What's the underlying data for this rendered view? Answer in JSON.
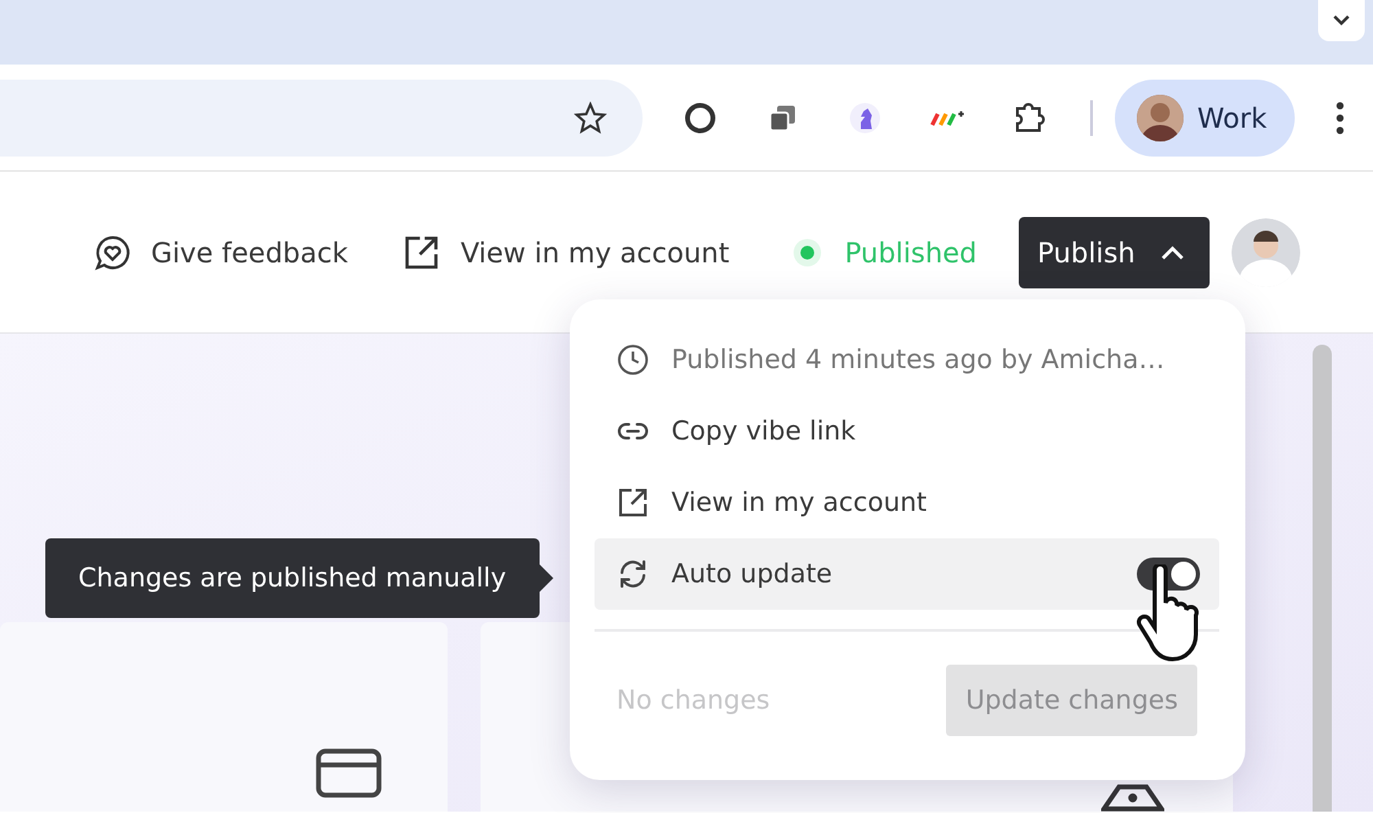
{
  "browser": {
    "profile": {
      "label": "Work"
    }
  },
  "header": {
    "feedback": "Give feedback",
    "view_account": "View in my account",
    "status": "Published",
    "publish_button": {
      "label": "Publish",
      "expanded": true
    }
  },
  "publish_menu": {
    "items": [
      {
        "kind": "info",
        "label": "Published 4 minutes ago by Amicha…",
        "selected": false
      },
      {
        "kind": "link",
        "label": "Copy vibe link",
        "selected": false
      },
      {
        "kind": "external",
        "label": "View in my account",
        "selected": false
      },
      {
        "kind": "toggle",
        "label": "Auto update",
        "on": true,
        "selected": true
      }
    ],
    "footer_note": "No changes",
    "update_button": {
      "label": "Update changes",
      "disabled": true
    }
  },
  "tooltip": "Changes are published manually"
}
